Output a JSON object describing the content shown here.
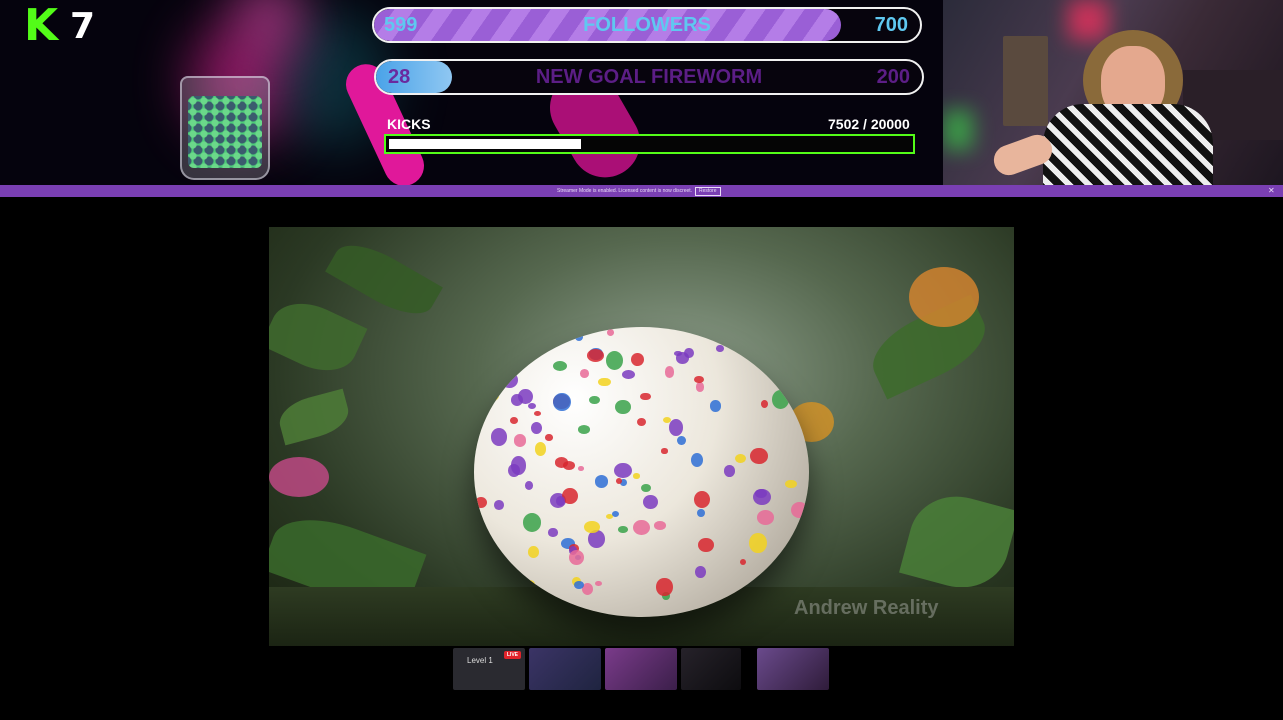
{
  "overlay": {
    "brand_logo": "K",
    "kick_count": "7",
    "followers_goal": {
      "current": "599",
      "title": "FOLLOWERS",
      "target": "700",
      "progress": 0.856
    },
    "firework_goal": {
      "current": "28",
      "title": "NEW GOAL FIREWORM",
      "target": "200",
      "progress": 0.14
    },
    "kicks": {
      "label": "KICKS",
      "value": "7502  / 20000",
      "progress": 0.375
    },
    "colors": {
      "kick_green": "#53fc18",
      "followers_purple": "#9a5fd6",
      "firework_blue": "#4aa3e8",
      "strip_purple": "#7a3fb3"
    }
  },
  "notice_strip": {
    "text": "Streamer Mode is enabled. Licensed content is now discreet.",
    "button_label": "Restore",
    "close_icon": "close-icon"
  },
  "video": {
    "watermark": "Andrew Reality"
  },
  "thumbnails": [
    {
      "caption": "Level 1",
      "live_badge": "LIVE",
      "color": "#2c2c32"
    },
    {
      "caption": "",
      "color": "#3b3466"
    },
    {
      "caption": "",
      "color": "#6a3b78"
    },
    {
      "caption": "",
      "color": "#1c1a1f"
    },
    {
      "caption": "",
      "color": "#5b3a6c"
    }
  ]
}
